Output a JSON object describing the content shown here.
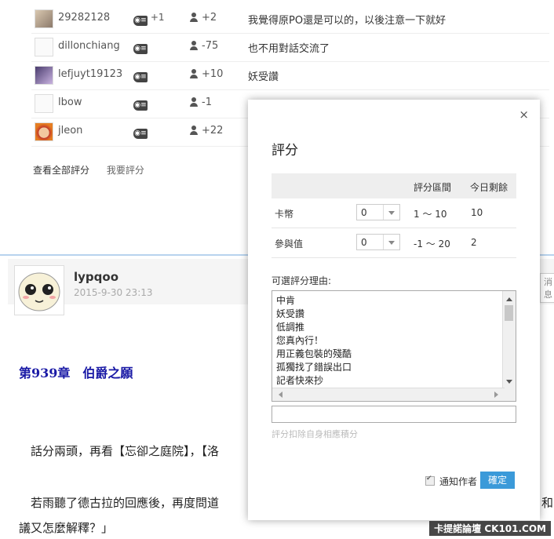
{
  "ratings": [
    {
      "user": "29282128",
      "coin": "+1",
      "contrib": "+2",
      "reason": "我覺得原PO還是可以的，以後注意一下就好"
    },
    {
      "user": "dillonchiang",
      "coin": "",
      "contrib": "-75",
      "reason": "也不用對話交流了"
    },
    {
      "user": "lefjuyt19123",
      "coin": "",
      "contrib": "+10",
      "reason": "妖受讚"
    },
    {
      "user": "lbow",
      "coin": "",
      "contrib": "-1",
      "reason": ""
    },
    {
      "user": "jleon",
      "coin": "",
      "contrib": "+22",
      "reason": ""
    }
  ],
  "rating_links": {
    "view_all": "查看全部評分",
    "rate": "我要評分"
  },
  "post": {
    "username": "lypqoo",
    "time": "2015-9-30 23:13",
    "right_button": "消息",
    "chapter": "第939章　伯爵之願",
    "para1": "　話分兩頭，再看【忘卻之庭院】，【洛",
    "para2": "　若雨聽了德古拉的回應後，再度問道",
    "para2_tail": "和",
    "para3": "議又怎麼解釋？」"
  },
  "modal": {
    "close": "×",
    "title": "評分",
    "col_range": "評分區間",
    "col_left": "今日剩餘",
    "rows": [
      {
        "label": "卡幣",
        "value": "0",
        "range": "1 ～ 10",
        "left": "10"
      },
      {
        "label": "參與值",
        "value": "0",
        "range": "-1 ～ 20",
        "left": "2"
      }
    ],
    "reason_label": "可選評分理由:",
    "reasons": [
      "中肯",
      "妖受讚",
      "低調推",
      "您真內行！",
      "用正義包裝的殘酷",
      "孤獨找了錯誤出口",
      "記者快來抄"
    ],
    "reason_input": "",
    "hint": "評分扣除自身相應積分",
    "notify": "通知作者",
    "confirm": "確定"
  },
  "watermark": "卡提諾論壇 CK101.COM"
}
